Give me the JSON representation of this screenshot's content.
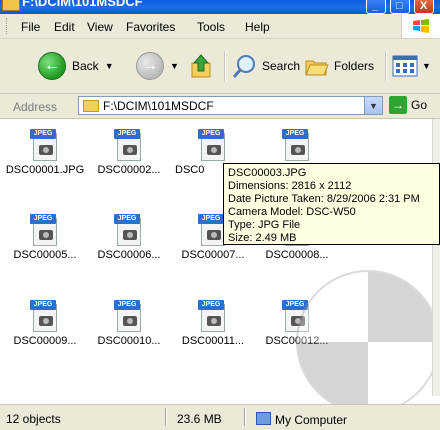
{
  "window": {
    "title": "F:\\DCIM\\101MSDCF",
    "buttons": [
      "_",
      "□",
      "X"
    ]
  },
  "menu": {
    "items": [
      "File",
      "Edit",
      "View",
      "Favorites",
      "Tools",
      "Help"
    ]
  },
  "toolbar": {
    "back_label": "Back",
    "search_label": "Search",
    "folders_label": "Folders"
  },
  "address": {
    "label": "Address",
    "value": "F:\\DCIM\\101MSDCF",
    "go_label": "Go"
  },
  "files": [
    {
      "label": "DSC00001.JPG"
    },
    {
      "label": "DSC00002..."
    },
    {
      "label": "DSC0"
    },
    {
      "label": ""
    },
    {
      "label": "DSC00005..."
    },
    {
      "label": "DSC00006..."
    },
    {
      "label": "DSC00007..."
    },
    {
      "label": "DSC00008..."
    },
    {
      "label": "DSC00009..."
    },
    {
      "label": "DSC00010..."
    },
    {
      "label": "DSC00011..."
    },
    {
      "label": "DSC00012..."
    }
  ],
  "tooltip": {
    "name": "DSC00003.JPG",
    "dimensions": "Dimensions: 2816 x 2112",
    "date": "Date Picture Taken: 8/29/2006 2:31 PM",
    "camera": "Camera Model: DSC-W50",
    "type": "Type: JPG File",
    "size": "Size: 2.49 MB"
  },
  "status": {
    "objects": "12 objects",
    "size": "23.6 MB",
    "zone": "My Computer"
  }
}
